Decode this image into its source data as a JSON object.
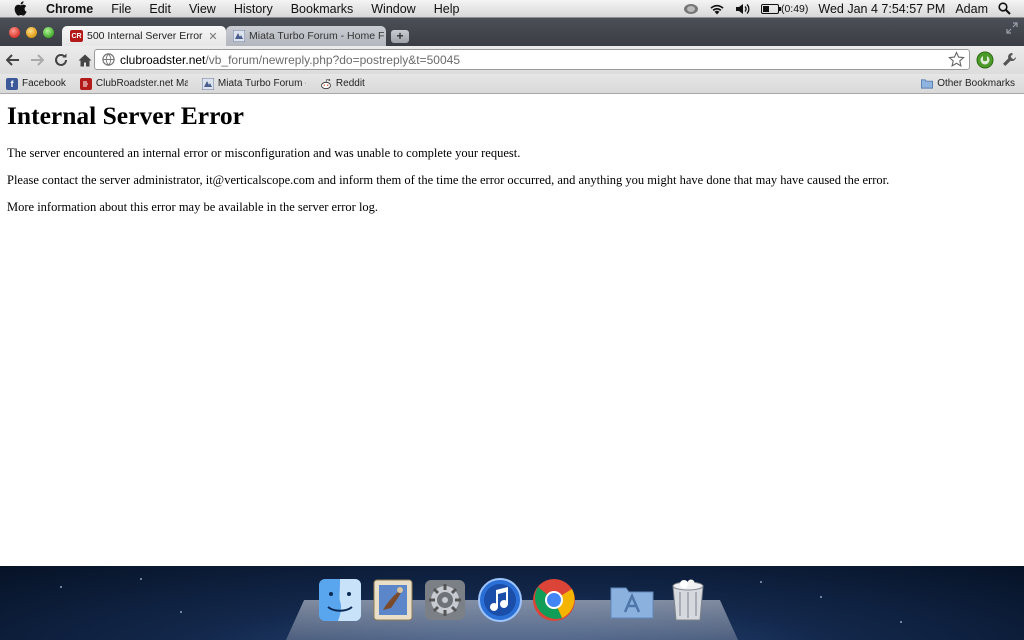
{
  "menubar": {
    "app_name": "Chrome",
    "items": [
      "File",
      "Edit",
      "View",
      "History",
      "Bookmarks",
      "Window",
      "Help"
    ],
    "battery": "(0:49)",
    "clock": "Wed Jan 4  7:54:57 PM",
    "user": "Adam"
  },
  "tabs": [
    {
      "title": "500 Internal Server Error",
      "favicon_text": "CR",
      "active": true
    },
    {
      "title": "Miata Turbo Forum - Home F",
      "active": false
    }
  ],
  "omnibox": {
    "url_host": "clubroadster.net",
    "url_path": "/vb_forum/newreply.php?do=postreply&t=50045"
  },
  "bookmarks": {
    "items": [
      {
        "label": "Facebook",
        "icon": "facebook-icon"
      },
      {
        "label": "ClubRoadster.net Ma",
        "icon": "clubroadster-icon"
      },
      {
        "label": "Miata Turbo Forum -",
        "icon": "miata-icon"
      },
      {
        "label": "Reddit",
        "icon": "reddit-icon"
      }
    ],
    "other": "Other Bookmarks"
  },
  "page": {
    "heading": "Internal Server Error",
    "p1": "The server encountered an internal error or misconfiguration and was unable to complete your request.",
    "p2": "Please contact the server administrator, it@verticalscope.com and inform them of the time the error occurred, and anything you might have done that may have caused the error.",
    "p3": "More information about this error may be available in the server error log."
  },
  "dock": {
    "apps": [
      "finder-icon",
      "mail-icon",
      "system-preferences-icon",
      "itunes-icon",
      "chrome-icon",
      "applications-folder-icon",
      "trash-icon"
    ]
  }
}
